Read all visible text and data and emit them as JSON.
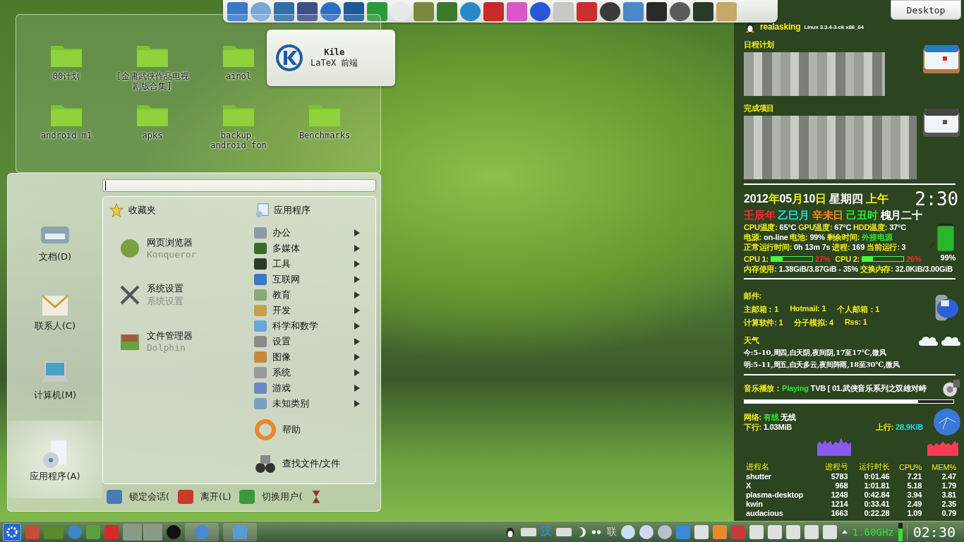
{
  "desktop_button": {
    "label": "Desktop"
  },
  "folder_view": {
    "rows": [
      [
        {
          "name": "00计划"
        },
        {
          "name": "[金庸武侠作品电视剧版合集]"
        },
        {
          "name": "ainol"
        }
      ],
      [
        {
          "name": "android_m1"
        },
        {
          "name": "apks"
        },
        {
          "name": "backup_ android_fon"
        },
        {
          "name": "Benchmarks"
        }
      ]
    ]
  },
  "tooltip": {
    "title": "Kile",
    "subtitle": "LaTeX 前端"
  },
  "launcher_menu": {
    "places": [
      {
        "label": "文档(D)",
        "selected": false
      },
      {
        "label": "联系人(C)",
        "selected": false
      },
      {
        "label": "计算机(M)",
        "selected": false
      },
      {
        "label": "应用程序(A)",
        "selected": true
      }
    ],
    "favorites_header": "收藏夹",
    "favorites": [
      {
        "name": "网页浏览器",
        "subtitle": "Konqueror"
      },
      {
        "name": "系统设置",
        "subtitle": "系统设置"
      },
      {
        "name": "文件管理器",
        "subtitle": "Dolphin"
      }
    ],
    "applications_header": "应用程序",
    "categories": [
      {
        "label": "办公"
      },
      {
        "label": "多媒体"
      },
      {
        "label": "工具"
      },
      {
        "label": "互联网"
      },
      {
        "label": "教育"
      },
      {
        "label": "开发"
      },
      {
        "label": "科学和数学"
      },
      {
        "label": "设置"
      },
      {
        "label": "图像"
      },
      {
        "label": "系统"
      },
      {
        "label": "游戏"
      },
      {
        "label": "未知类别"
      }
    ],
    "actions": [
      {
        "label": "帮助"
      },
      {
        "label": "查找文件/文件"
      }
    ],
    "session_buttons": [
      {
        "label": "锁定会话("
      },
      {
        "label": "离开(L)"
      },
      {
        "label": "切换用户("
      }
    ]
  },
  "monitor": {
    "user": "realasking",
    "kernel": "Linux 3.3.4-3-ck x86_64",
    "schedule_title": "日程计划",
    "completed_title": "完成项目",
    "date": [
      {
        "text": "2012",
        "color": "#ffffff"
      },
      {
        "text": "年",
        "color": "#f2ee1e"
      },
      {
        "text": "05",
        "color": "#ffffff"
      },
      {
        "text": "月",
        "color": "#f2ee1e"
      },
      {
        "text": "10",
        "color": "#ffffff"
      },
      {
        "text": "日",
        "color": "#f2ee1e"
      },
      {
        "text": " 星期四 ",
        "color": "#ffffff"
      },
      {
        "text": "上午",
        "color": "#f2ee1e"
      }
    ],
    "clock": "2:30",
    "lunar": [
      {
        "text": "壬辰年 ",
        "color": "#ff2a2a"
      },
      {
        "text": "乙巳月 ",
        "color": "#28d8e8"
      },
      {
        "text": "辛未日 ",
        "color": "#ff8a1a"
      },
      {
        "text": "己丑时 ",
        "color": "#2ee82e"
      },
      {
        "text": "槐月二十",
        "color": "#ffffff"
      }
    ],
    "status_lines": [
      [
        {
          "text": "CPU温度:",
          "color": "#f2ee1e"
        },
        {
          "text": " 65°C ",
          "color": "#ffffff"
        },
        {
          "text": "GPU温度:",
          "color": "#f2ee1e"
        },
        {
          "text": " 67°C ",
          "color": "#ffffff"
        },
        {
          "text": "HDD温度:",
          "color": "#f2ee1e"
        },
        {
          "text": " 37°C",
          "color": "#ffffff"
        }
      ],
      [
        {
          "text": "电源:",
          "color": "#f2ee1e"
        },
        {
          "text": " on-line ",
          "color": "#ffffff"
        },
        {
          "text": "电池:",
          "color": "#f2ee1e"
        },
        {
          "text": " 99% ",
          "color": "#ffffff"
        },
        {
          "text": "剩余时间:",
          "color": "#f2ee1e"
        },
        {
          "text": " 外接电源",
          "color": "#2ee82e"
        }
      ],
      [
        {
          "text": "正常运行时间:",
          "color": "#f2ee1e"
        },
        {
          "text": " 0h 13m 7s ",
          "color": "#ffffff"
        },
        {
          "text": "进程:",
          "color": "#f2ee1e"
        },
        {
          "text": " 169 ",
          "color": "#ffffff"
        },
        {
          "text": "当前运行:",
          "color": "#f2ee1e"
        },
        {
          "text": " 3",
          "color": "#ffffff"
        }
      ]
    ],
    "cpus": [
      {
        "label": "CPU 1:",
        "level": 0.27,
        "reading": "27%"
      },
      {
        "label": "CPU 2:",
        "level": 0.26,
        "reading": "26%"
      }
    ],
    "battery_reading": "99%",
    "memory": [
      {
        "text": "内存使用:",
        "color": "#f2ee1e"
      },
      {
        "text": " 1.38GiB/3.87GiB - 35% ",
        "color": "#ffffff"
      },
      {
        "text": "交换内存:",
        "color": "#f2ee1e"
      },
      {
        "text": " 32.0KiB/3.00GiB",
        "color": "#ffffff"
      }
    ],
    "mail_title": "邮件:",
    "mail_lines": [
      [
        "主邮箱：1",
        "Hotmail: 1",
        "个人邮箱：1"
      ],
      [
        "计算软件: 1",
        "分子模拟: 4",
        "Rss: 1"
      ]
    ],
    "weather_title": "天气",
    "weather_lines": [
      "今:5–10,周四,白天阴,夜间阴,17至17℃,微风",
      "明:5–11,周五,白天多云,夜间阵雨,18至30℃,微风"
    ],
    "music": [
      {
        "text": "音乐播放：",
        "color": "#f2ee1e"
      },
      {
        "text": "Playing ",
        "color": "#2ee82e"
      },
      {
        "text": "TVB [ 01.武侠音乐系列之双雄对峙",
        "color": "#ffffff"
      }
    ],
    "music_progress": {
      "level": 0.83
    },
    "network": [
      {
        "text": "网络: ",
        "color": "#f2ee1e"
      },
      {
        "text": "有线 ",
        "color": "#2ee82e"
      },
      {
        "text": "无线",
        "color": "#ffffff"
      }
    ],
    "download": [
      {
        "text": "下行: ",
        "color": "#f2ee1e"
      },
      {
        "text": "1.03MiB",
        "color": "#ffffff"
      }
    ],
    "upload": [
      {
        "text": "上行: ",
        "color": "#f2ee1e"
      },
      {
        "text": "28.9KiB",
        "color": "#28d8e8"
      }
    ],
    "processes": {
      "columns": [
        "进程名",
        "进程号",
        "运行时长",
        "CPU%",
        "MEM%"
      ],
      "rows": [
        [
          "shutter",
          "5783",
          "0:01.46",
          "7.21",
          "2.47"
        ],
        [
          "X",
          "968",
          "1:01.81",
          "5.18",
          "1.79"
        ],
        [
          "plasma-desktop",
          "1248",
          "0:42.84",
          "3.94",
          "3.81"
        ],
        [
          "kwin",
          "1214",
          "0:33.41",
          "2.49",
          "2.35"
        ],
        [
          "audacious",
          "1663",
          "0:22.28",
          "1.09",
          "0.79"
        ]
      ]
    }
  },
  "taskbar": {
    "input_method": "汉",
    "tray_label": "联",
    "cpu_frequency": "1.60GHz",
    "clock": "02:30"
  }
}
